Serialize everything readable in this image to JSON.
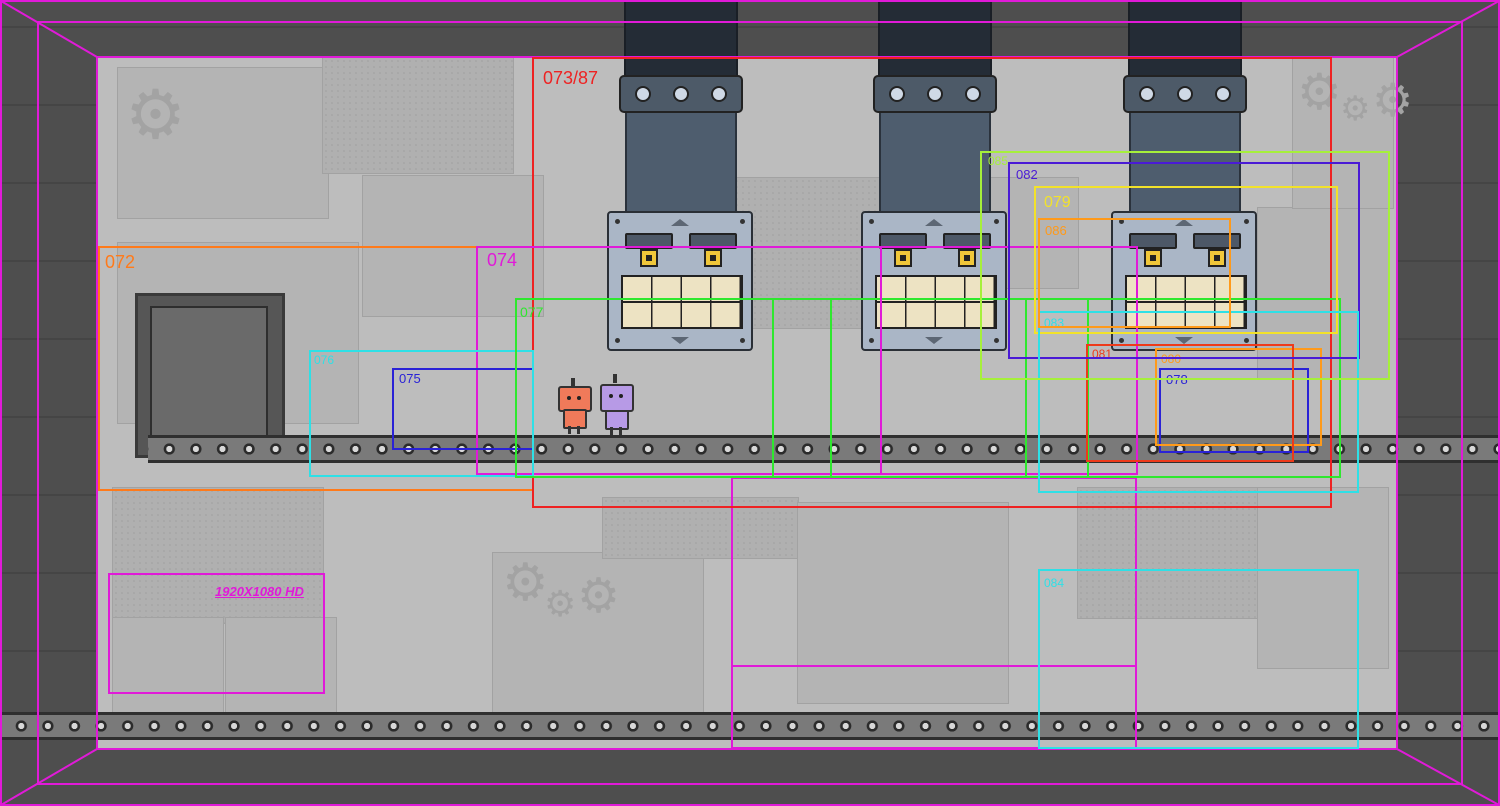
{
  "scene": {
    "resolution_label": "1920X1080 HD"
  },
  "camera_boxes": [
    {
      "id": "072",
      "label": "072",
      "color": "#ff7a1a"
    },
    {
      "id": "073",
      "label": "073/87",
      "color": "#ee2222"
    },
    {
      "id": "074",
      "label": "074",
      "color": "#e01ad8"
    },
    {
      "id": "075",
      "label": "075",
      "color": "#2a22d6"
    },
    {
      "id": "076",
      "label": "076",
      "color": "#2ee0e6"
    },
    {
      "id": "077",
      "label": "077",
      "color": "#2ee82e"
    },
    {
      "id": "078",
      "label": "078",
      "color": "#2a22d6"
    },
    {
      "id": "079",
      "label": "079",
      "color": "#f2e22a"
    },
    {
      "id": "080",
      "label": "080",
      "color": "#ff9a1a"
    },
    {
      "id": "081",
      "label": "081",
      "color": "#ee3a1a"
    },
    {
      "id": "082",
      "label": "082",
      "color": "#4a1ad6"
    },
    {
      "id": "083",
      "label": "083",
      "color": "#2ee0e6"
    },
    {
      "id": "084",
      "label": "084",
      "color": "#2ee0e6"
    },
    {
      "id": "085",
      "label": "085",
      "color": "#a6f03a"
    },
    {
      "id": "086",
      "label": "086",
      "color": "#ff9a1a"
    }
  ],
  "colors": {
    "frame": "#e01ad8",
    "wall": "#bdbdbd",
    "crusher": "#aab6c6",
    "pipe": "#4e5d6e",
    "robot_red": "#f07a5a",
    "robot_purple": "#b79ae6"
  }
}
